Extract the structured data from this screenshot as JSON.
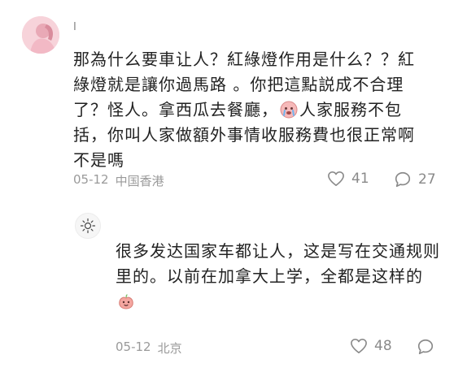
{
  "comments": [
    {
      "username": "I",
      "text": "那為什么要車让人？紅綠燈作用是什么？？紅綠燈就是讓你過馬路 。你把這點説成不合理了？怪人。拿西瓜去餐廳，",
      "text_after_emoji": "人家服務不包括，你叫人家做額外事情收服務費也很正常啊不是嗎",
      "emoji_icon": "crying-face-sticker-icon",
      "date": "05-12",
      "location": "中国香港",
      "likes": "41",
      "replies": "27"
    },
    {
      "text": "很多发达国家车都让人，这是写在交通规则里的。以前在加拿大上学，全都是这样的",
      "emoji_icon": "peach-face-sticker-icon",
      "date": "05-12",
      "location": "北京",
      "likes": "48"
    }
  ],
  "colors": {
    "text": "#222222",
    "meta": "#9a9a9a",
    "icon": "#8a8a8a"
  }
}
